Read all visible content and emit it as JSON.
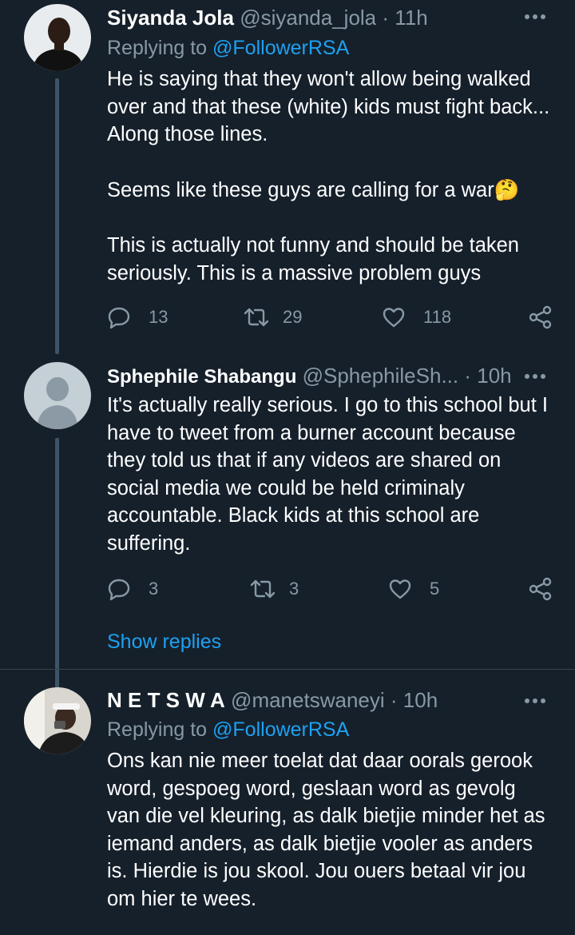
{
  "tweets": [
    {
      "name": "Siyanda Jola",
      "handle": "@siyanda_jola",
      "time": "11h",
      "replying_prefix": "Replying to",
      "replying_to": "@FollowerRSA",
      "paragraphs": [
        "He is saying that they won't allow being walked over and that these (white) kids must fight back... Along those lines.",
        "Seems like these guys are calling for a war🤔",
        "This is actually not funny and should be taken seriously. This is a massive problem guys"
      ],
      "replies": "13",
      "retweets": "29",
      "likes": "118"
    },
    {
      "name": "Sphephile Shabangu",
      "handle": "@SphephileSh...",
      "time": "10h",
      "paragraphs": [
        "It's actually really serious. I go to this school but I have to tweet from a burner account because they told us that if any videos are shared on social media we could be held criminaly accountable. Black kids at this school are suffering."
      ],
      "replies": "3",
      "retweets": "3",
      "likes": "5"
    },
    {
      "name": "N E T S W A",
      "handle": "@manetswaneyi",
      "time": "10h",
      "replying_prefix": "Replying to",
      "replying_to": "@FollowerRSA",
      "paragraphs": [
        "Ons kan nie meer toelat dat daar oorals gerook word, gespoeg word, geslaan word as gevolg van die vel kleuring, as dalk bietjie minder het as iemand anders, as dalk bietjie vooler as anders is. Hierdie is jou skool. Jou ouers betaal vir jou om hier te wees."
      ]
    }
  ],
  "show_replies": "Show replies",
  "colors": {
    "background": "#15202b",
    "text": "#ffffff",
    "muted": "#8899a6",
    "link": "#1da1f2",
    "thread_line": "#3d5466"
  },
  "icons": [
    "reply-icon",
    "retweet-icon",
    "like-icon",
    "share-icon",
    "more-icon"
  ]
}
